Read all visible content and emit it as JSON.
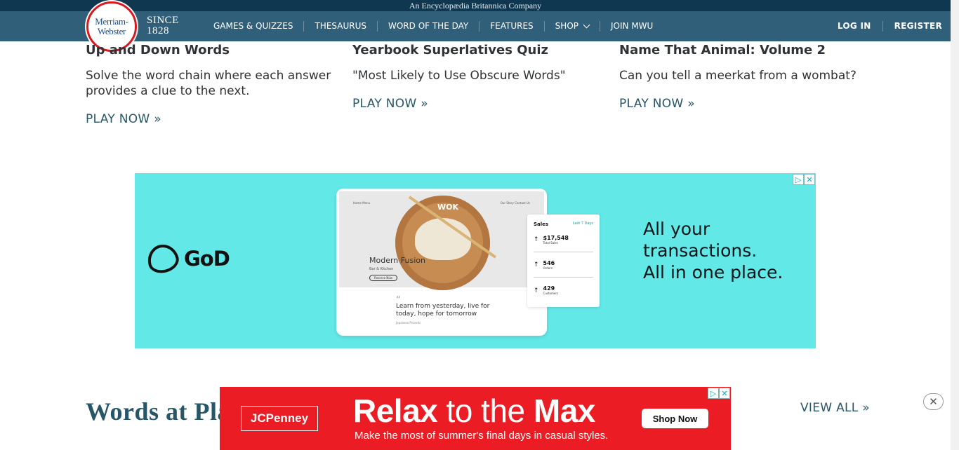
{
  "header": {
    "tagline": "An Encyclopædia Britannica Company",
    "logo_line1": "Merriam-",
    "logo_line2": "Webster",
    "since_line1": "SINCE",
    "since_line2": "1828",
    "nav": [
      {
        "label": "GAMES & QUIZZES"
      },
      {
        "label": "THESAURUS"
      },
      {
        "label": "WORD OF THE DAY"
      },
      {
        "label": "FEATURES"
      },
      {
        "label": "SHOP"
      },
      {
        "label": "JOIN MWU"
      }
    ],
    "login": "LOG IN",
    "register": "REGISTER"
  },
  "cards": [
    {
      "title": "Up and Down Words",
      "desc": "Solve the word chain where each answer provides a clue to the next.",
      "link": "PLAY NOW »"
    },
    {
      "title": "Yearbook Superlatives Quiz",
      "desc": "\"Most Likely to Use Obscure Words\"",
      "link": "PLAY NOW »"
    },
    {
      "title": "Name That Animal: Volume 2",
      "desc": "Can you tell a meerkat from a wombat?",
      "link": "PLAY NOW »"
    }
  ],
  "ad1": {
    "brand": "GoD",
    "mock_heading": "Modern Fusion",
    "mock_sub": "Bar & Kitchen",
    "mock_button": "Reserve Now",
    "mock_logo": "WOK",
    "mock_nav_left": "Home    Menu",
    "mock_nav_right": "Our Story    Contact Us",
    "mock_quote": "Learn from yesterday, live for today, hope for tomorrow",
    "mock_author": "Japanese Proverb",
    "sales_title": "Sales",
    "sales_period": "Last 7 Days",
    "sales_rows": [
      {
        "value": "$17,548",
        "label": "Total Sales"
      },
      {
        "value": "546",
        "label": "Orders"
      },
      {
        "value": "429",
        "label": "Customers"
      }
    ],
    "copy": "All your transactions. All in one place."
  },
  "section": {
    "title": "Words at Play",
    "view_all": "VIEW ALL »"
  },
  "ad2": {
    "brand": "JCPenney",
    "headline_bold1": "Relax",
    "headline_mid": " to the ",
    "headline_bold2": "Max",
    "sub": "Make the most of summer's final days in casual styles.",
    "cta": "Shop Now"
  },
  "icons": {
    "adchoices": "▷",
    "close": "✕"
  }
}
